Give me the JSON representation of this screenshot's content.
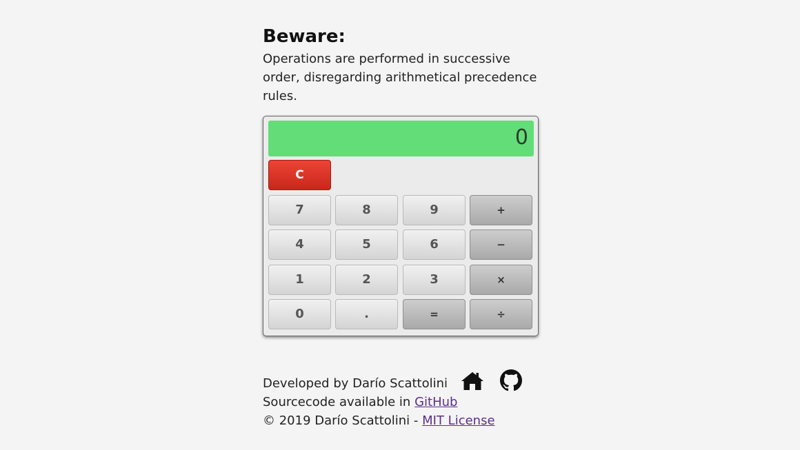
{
  "warning": {
    "title": "Beware:",
    "text": "Operations are performed in successive order, disregarding arithmetical precedence rules."
  },
  "calculator": {
    "display": "0",
    "clear_label": "C",
    "keys": {
      "k7": "7",
      "k8": "8",
      "k9": "9",
      "plus": "+",
      "k4": "4",
      "k5": "5",
      "k6": "6",
      "minus": "−",
      "k1": "1",
      "k2": "2",
      "k3": "3",
      "times": "×",
      "k0": "0",
      "dot": ".",
      "equals": "=",
      "divide": "÷"
    },
    "colors": {
      "display_bg": "#62dd77",
      "clear_bg": "#d9342a"
    }
  },
  "footer": {
    "developed_by": "Developed by Darío Scattolini",
    "source_prefix": "Sourcecode available in ",
    "source_link": "GitHub",
    "copyright_prefix": "© 2019 Darío Scattolini - ",
    "license_link": "MIT License",
    "icons": [
      "home-icon",
      "github-icon"
    ]
  }
}
